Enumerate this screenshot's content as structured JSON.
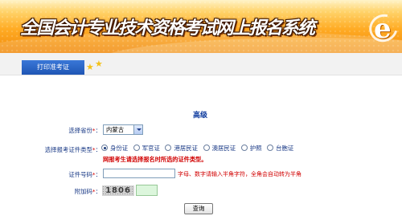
{
  "header": {
    "title": "全国会计专业技术资格考试网上报名系统",
    "logo_letter": "e"
  },
  "nav": {
    "active_tab": "打印准考证"
  },
  "form": {
    "section_title": "高级",
    "province": {
      "label": "选择省份",
      "required_mark": "*",
      "value": "内蒙古"
    },
    "doc_type": {
      "label": "选择报考证件类型",
      "required_mark": "*",
      "options": [
        "身份证",
        "军官证",
        "港居民证",
        "澳居民证",
        "护照",
        "台胞证"
      ],
      "selected_index": 0,
      "warning": "网报考生请选择报名时所选的证件类型。"
    },
    "doc_number": {
      "label": "证件号码",
      "required_mark": "*",
      "value": "",
      "hint": "字母、数字请输入半角字符，全角会自动转为半角"
    },
    "captcha": {
      "label": "附加码",
      "required_mark": "*",
      "code": "1806",
      "value": ""
    },
    "submit_label": "查询"
  },
  "colors": {
    "label": "#1a3a86",
    "required": "#d10000",
    "tab": "#2a64c6",
    "banner": "#ffab23"
  }
}
